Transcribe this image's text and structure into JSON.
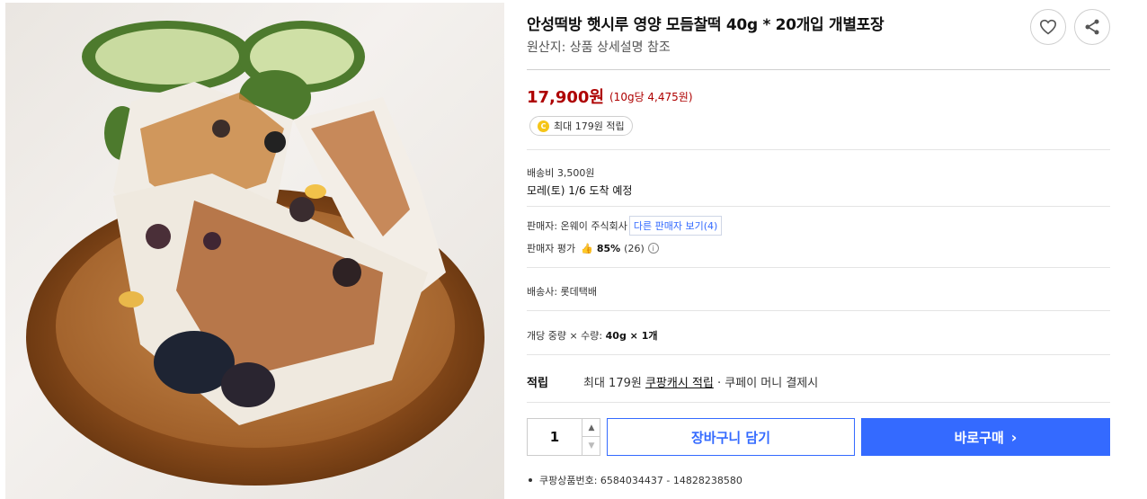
{
  "product": {
    "image_alt": "",
    "title": "안성떡방 햇시루 영양 모듬찰떡 40g * 20개입 개별포장",
    "origin": "원산지: 상품 상세설명 참조"
  },
  "actions": {
    "wishlist_icon": "heart-icon",
    "share_icon": "share-icon"
  },
  "pricing": {
    "price": "17,900원",
    "unit_price": "(10g당 4,475원)",
    "reward_badge": "최대 179원 적립",
    "coin_symbol": "C"
  },
  "delivery": {
    "fee": "배송비 3,500원",
    "arrival": "모레(토) 1/6 도착 예정"
  },
  "seller": {
    "label": "판매자: 온웨이 주식회사",
    "other_sellers": "다른 판매자 보기(4)",
    "rating_label": "판매자 평가",
    "rating_pct": "85%",
    "rating_count": "(26)"
  },
  "shipping": {
    "carrier": "배송사: 롯데택배"
  },
  "option": {
    "label": "개당 중량 × 수량: ",
    "value": "40g × 1개"
  },
  "reward": {
    "label": "적립",
    "prefix": "최대 179원 ",
    "link": "쿠팡캐시 적립",
    "suffix": " · 쿠페이 머니 결제시"
  },
  "purchase": {
    "quantity": "1",
    "cart_label": "장바구니 담기",
    "buy_label": "바로구매",
    "buy_chevron": "›"
  },
  "product_number": "쿠팡상품번호: 6584034437 - 14828238580",
  "colors": {
    "accent": "#346aff",
    "price": "#ae0000",
    "coin": "#f5c518"
  }
}
